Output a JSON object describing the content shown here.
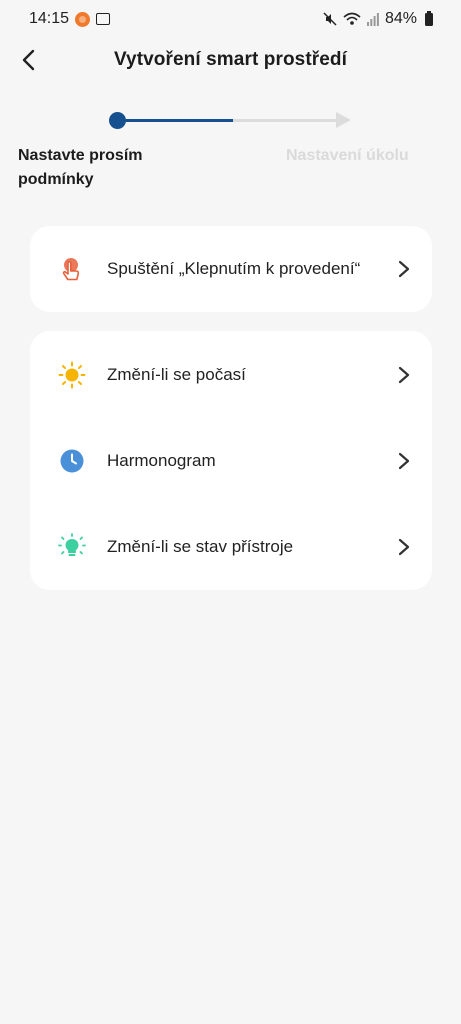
{
  "status_bar": {
    "time": "14:15",
    "battery": "84%"
  },
  "header": {
    "title": "Vytvoření smart prostředí"
  },
  "stepper": {
    "step1_label": "Nastavte prosím podmínky",
    "step2_label": "Nastavení úkolu",
    "active_color": "#17508f",
    "inactive_color": "#dcdcdc"
  },
  "trigger_card": {
    "items": [
      {
        "label": "Spuštění „Klepnutím k provedení“",
        "icon": "tap-hand-icon",
        "icon_color": "#e8603c"
      }
    ]
  },
  "conditions_card": {
    "items": [
      {
        "label": "Změní-li se počasí",
        "icon": "sun-icon",
        "icon_color": "#f4b400"
      },
      {
        "label": "Harmonogram",
        "icon": "clock-icon",
        "icon_color": "#4a90d9"
      },
      {
        "label": "Změní-li se stav přístroje",
        "icon": "bulb-icon",
        "icon_color": "#3ccf9f"
      }
    ]
  }
}
